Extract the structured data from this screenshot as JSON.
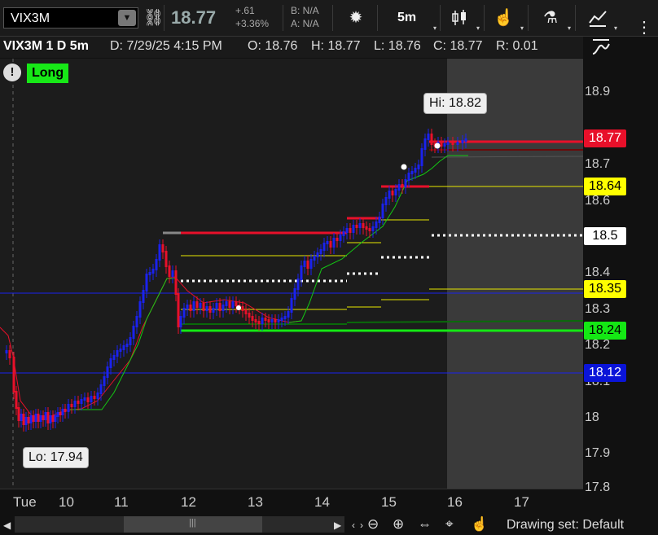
{
  "toolbar": {
    "symbol": "VIX3M",
    "last_price": "18.77",
    "change_abs": "+.61",
    "change_pct": "+3.36%",
    "bid": "B: N/A",
    "ask": "A: N/A",
    "timeframe": "5m",
    "icons": [
      "dropdown-arrow-icon",
      "link-icon",
      "gear-icon",
      "candlestick-icon",
      "hand-pointer-icon",
      "flask-icon",
      "drawing-icon",
      "expand-icon"
    ]
  },
  "infobar": {
    "title": "VIX3M 1 D 5m",
    "date": "D: 7/29/25 4:15 PM",
    "open": "O: 18.76",
    "high": "H: 18.77",
    "low": "L: 18.76",
    "close": "C: 18.77",
    "range": "R: 0.01"
  },
  "badges": {
    "alert": "!",
    "position": "Long"
  },
  "callouts": {
    "hi": "Hi: 18.82",
    "lo": "Lo: 17.94"
  },
  "price_axis": {
    "ticks": [
      "18.9",
      "18.7",
      "18.6",
      "18.4",
      "18.3",
      "18.2",
      "18.1",
      "18",
      "17.9",
      "17.8"
    ],
    "tags": [
      {
        "label": "18.77",
        "bg": "#e8102a",
        "fg": "#ffffff"
      },
      {
        "label": "18.64",
        "bg": "#ffff00",
        "fg": "#000000"
      },
      {
        "label": "18.5",
        "bg": "#ffffff",
        "fg": "#000000"
      },
      {
        "label": "18.35",
        "bg": "#ffff00",
        "fg": "#000000"
      },
      {
        "label": "18.24",
        "bg": "#14e814",
        "fg": "#000000"
      },
      {
        "label": "18.12",
        "bg": "#0a14d8",
        "fg": "#ffffff"
      }
    ]
  },
  "time_axis": {
    "labels": [
      "Tue",
      "10",
      "11",
      "12",
      "13",
      "14",
      "15",
      "16",
      "17"
    ]
  },
  "bottom_bar": {
    "drawing_set": "Drawing set: Default",
    "icons": [
      "zoom-out-icon",
      "zoom-in-icon",
      "pan-icon",
      "crosshair-icon",
      "hand-icon"
    ]
  },
  "colors": {
    "up": "#1a22ee",
    "down": "#e8102a",
    "signal_green": "#14c814",
    "level_yellow": "#e8e800"
  }
}
